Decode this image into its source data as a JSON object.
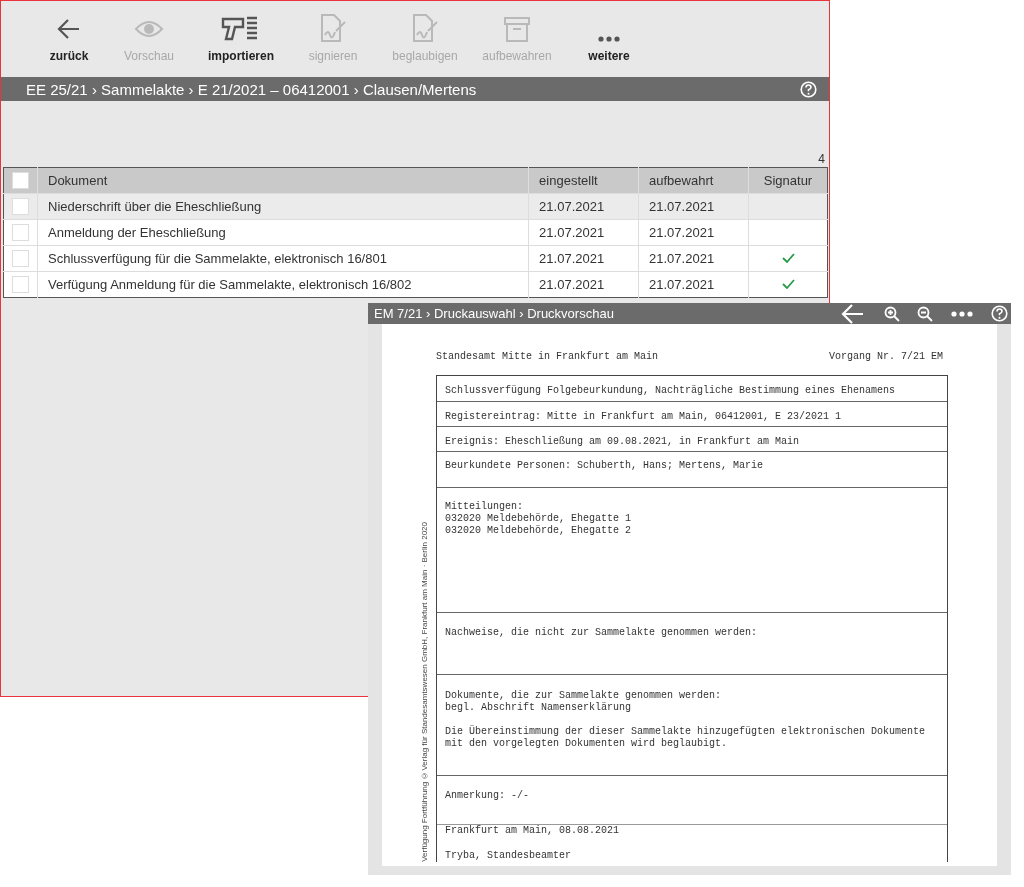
{
  "main_window": {
    "toolbar": [
      {
        "kind": "back",
        "label": "zurück",
        "disabled": false
      },
      {
        "kind": "eye",
        "label": "Vorschau",
        "disabled": true
      },
      {
        "kind": "scanner",
        "label": "importieren",
        "disabled": false
      },
      {
        "kind": "sign",
        "label": "signieren",
        "disabled": true
      },
      {
        "kind": "certify",
        "label": "beglaubigen",
        "disabled": true
      },
      {
        "kind": "archive",
        "label": "aufbewahren",
        "disabled": true
      },
      {
        "kind": "more",
        "label": "weitere",
        "disabled": false
      }
    ],
    "breadcrumb": "EE 25/21 › Sammelakte › E 21/2021 – 06412001 › Clausen/Mertens",
    "count": "4",
    "table": {
      "all_checked": false,
      "columns": [
        "Dokument",
        "eingestellt",
        "aufbewahrt",
        "Signatur"
      ],
      "rows": [
        {
          "selected": true,
          "checked": false,
          "cells": [
            "Niederschrift über die Eheschließung",
            "21.07.2021",
            "21.07.2021"
          ],
          "signed": false
        },
        {
          "selected": false,
          "checked": false,
          "cells": [
            "Anmeldung der Eheschließung",
            "21.07.2021",
            "21.07.2021"
          ],
          "signed": false
        },
        {
          "selected": false,
          "checked": false,
          "cells": [
            "Schlussverfügung für die Sammelakte, elektronisch 16/801",
            "21.07.2021",
            "21.07.2021"
          ],
          "signed": true
        },
        {
          "selected": false,
          "checked": false,
          "cells": [
            "Verfügung Anmeldung für die Sammelakte, elektronisch 16/802",
            "21.07.2021",
            "21.07.2021"
          ],
          "signed": true
        }
      ]
    }
  },
  "preview_window": {
    "breadcrumb": "EM 7/21 › Druckauswahl › Druckvorschau",
    "tools": [
      {
        "kind": "back"
      },
      {
        "kind": "zoom_in"
      },
      {
        "kind": "zoom_out"
      },
      {
        "kind": "more"
      },
      {
        "kind": "help"
      }
    ],
    "document": {
      "header_left": "Standesamt Mitte in Frankfurt am Main",
      "header_right": "Vorgang Nr. 7/21 EM",
      "margin_note": "Verfügung Fortführung ©Verlag für Standesamtswesen GmbH, Frankfurt am Main · Berlin 2020",
      "sections": [
        {
          "paragraphs": [
            [
              "Schlussverfügung Folgebeurkundung, Nachträgliche Bestimmung eines Ehenamens"
            ]
          ]
        },
        {
          "paragraphs": [
            [
              "Registereintrag: Mitte in Frankfurt am Main, 06412001, E 23/2021 1"
            ]
          ]
        },
        {
          "paragraphs": [
            [
              "Ereignis: Eheschließung am 09.08.2021, in Frankfurt am Main"
            ]
          ]
        },
        {
          "paragraphs": [
            [
              "Beurkundete Personen: Schuberth, Hans; Mertens, Marie"
            ]
          ]
        },
        {
          "paragraphs": [
            [
              "Mitteilungen:",
              "032020 Meldebehörde, Ehegatte 1",
              "032020 Meldebehörde, Ehegatte 2"
            ]
          ]
        },
        {
          "paragraphs": [
            [
              "Nachweise, die nicht zur Sammelakte genommen werden:"
            ]
          ]
        },
        {
          "paragraphs": [
            [
              "Dokumente, die zur Sammelakte genommen werden:",
              "begl. Abschrift Namenserklärung"
            ],
            [
              "Die Übereinstimmung der dieser Sammelakte hinzugefügten elektronischen Dokumente",
              "mit den vorgelegten Dokumenten wird beglaubigt."
            ]
          ]
        },
        {
          "paragraphs": [
            [
              "Anmerkung: -/-"
            ]
          ]
        },
        {
          "paragraphs": [
            [
              "Frankfurt am Main, 08.08.2021"
            ],
            [
              "Tryba, Standesbeamter"
            ]
          ]
        }
      ]
    }
  }
}
